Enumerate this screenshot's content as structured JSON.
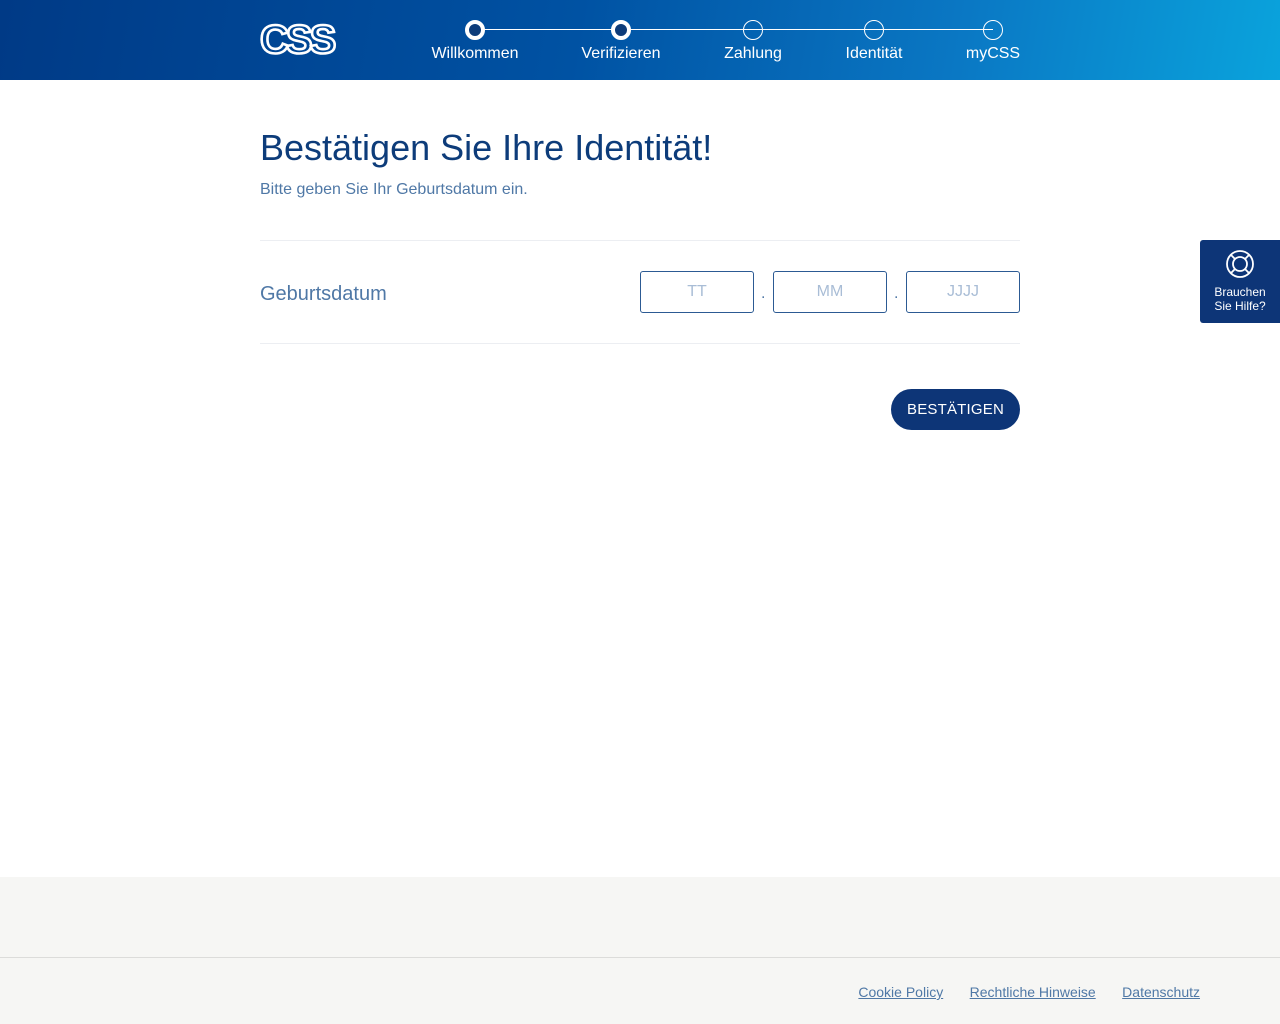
{
  "header": {
    "logo_text": "CSS",
    "steps": [
      {
        "label": "Willkommen",
        "completed": true
      },
      {
        "label": "Verifizieren",
        "completed": true
      },
      {
        "label": "Zahlung",
        "completed": false
      },
      {
        "label": "Identität",
        "completed": false
      },
      {
        "label": "myCSS",
        "completed": false
      }
    ]
  },
  "main": {
    "title": "Bestätigen Sie Ihre Identität!",
    "subtitle": "Bitte geben Sie Ihr Geburtsdatum ein.",
    "birthdate": {
      "label": "Geburtsdatum",
      "day_placeholder": "TT",
      "month_placeholder": "MM",
      "year_placeholder": "JJJJ",
      "separator": "."
    },
    "confirm_label": "BESTÄTIGEN"
  },
  "help": {
    "line1": "Brauchen",
    "line2": "Sie Hilfe?",
    "icon": "lifebuoy-icon"
  },
  "footer": {
    "links": [
      "Cookie Policy",
      "Rechtliche Hinweise",
      "Datenschutz"
    ]
  },
  "colors": {
    "brand_dark": "#0d3577",
    "brand_blue": "#0052a3",
    "text_blue": "#4f78a6",
    "title_blue": "#0d3c7a"
  }
}
